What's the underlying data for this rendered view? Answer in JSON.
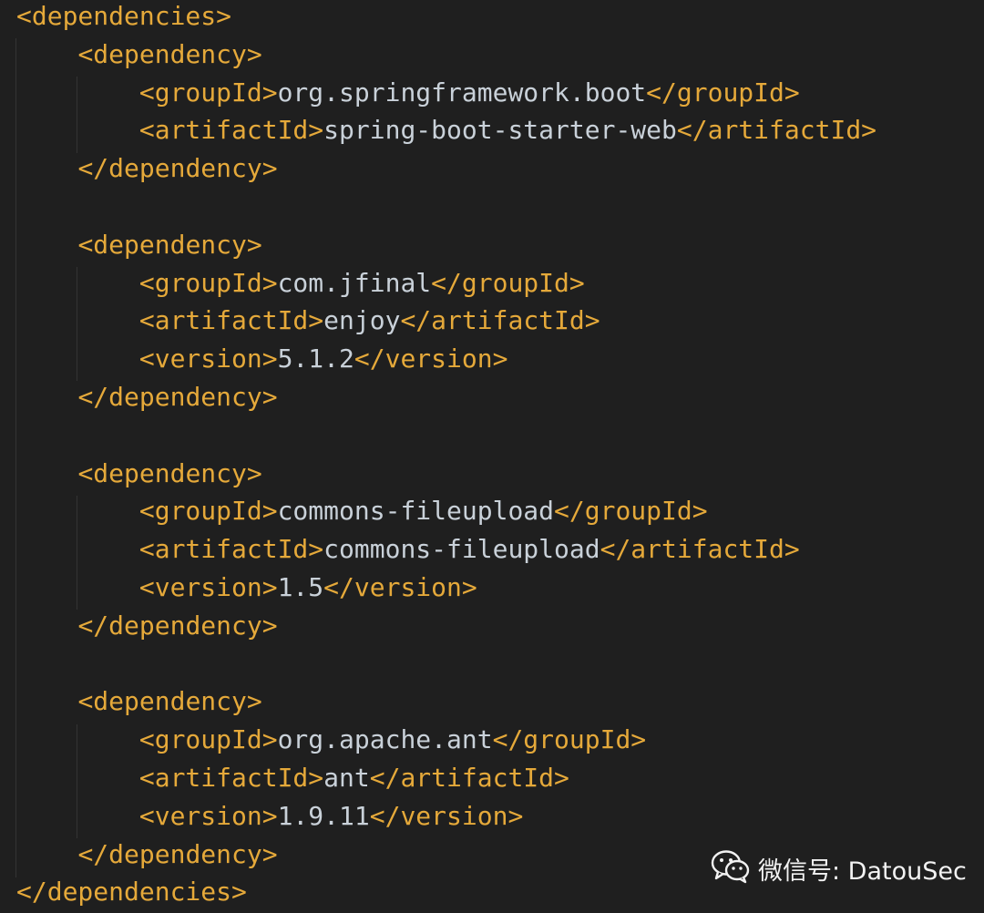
{
  "code": {
    "language": "xml",
    "lines": [
      {
        "indent": 0,
        "parts": [
          {
            "cls": "tag",
            "text": "<dependencies>"
          }
        ]
      },
      {
        "indent": 1,
        "parts": [
          {
            "cls": "tag",
            "text": "<dependency>"
          }
        ]
      },
      {
        "indent": 2,
        "parts": [
          {
            "cls": "tag",
            "text": "<groupId>"
          },
          {
            "cls": "txt",
            "text": "org.springframework.boot"
          },
          {
            "cls": "tag",
            "text": "</groupId>"
          }
        ]
      },
      {
        "indent": 2,
        "parts": [
          {
            "cls": "tag",
            "text": "<artifactId>"
          },
          {
            "cls": "txt",
            "text": "spring-boot-starter-web"
          },
          {
            "cls": "tag",
            "text": "</artifactId>"
          }
        ]
      },
      {
        "indent": 1,
        "parts": [
          {
            "cls": "tag",
            "text": "</dependency>"
          }
        ]
      },
      {
        "indent": 0,
        "parts": []
      },
      {
        "indent": 1,
        "parts": [
          {
            "cls": "tag",
            "text": "<dependency>"
          }
        ]
      },
      {
        "indent": 2,
        "parts": [
          {
            "cls": "tag",
            "text": "<groupId>"
          },
          {
            "cls": "txt",
            "text": "com.jfinal"
          },
          {
            "cls": "tag",
            "text": "</groupId>"
          }
        ]
      },
      {
        "indent": 2,
        "parts": [
          {
            "cls": "tag",
            "text": "<artifactId>"
          },
          {
            "cls": "txt",
            "text": "enjoy"
          },
          {
            "cls": "tag",
            "text": "</artifactId>"
          }
        ]
      },
      {
        "indent": 2,
        "parts": [
          {
            "cls": "tag",
            "text": "<version>"
          },
          {
            "cls": "txt",
            "text": "5.1.2"
          },
          {
            "cls": "tag",
            "text": "</version>"
          }
        ]
      },
      {
        "indent": 1,
        "parts": [
          {
            "cls": "tag",
            "text": "</dependency>"
          }
        ]
      },
      {
        "indent": 0,
        "parts": []
      },
      {
        "indent": 1,
        "parts": [
          {
            "cls": "tag",
            "text": "<dependency>"
          }
        ]
      },
      {
        "indent": 2,
        "parts": [
          {
            "cls": "tag",
            "text": "<groupId>"
          },
          {
            "cls": "txt",
            "text": "commons-fileupload"
          },
          {
            "cls": "tag",
            "text": "</groupId>"
          }
        ]
      },
      {
        "indent": 2,
        "parts": [
          {
            "cls": "tag",
            "text": "<artifactId>"
          },
          {
            "cls": "txt",
            "text": "commons-fileupload"
          },
          {
            "cls": "tag",
            "text": "</artifactId>"
          }
        ]
      },
      {
        "indent": 2,
        "parts": [
          {
            "cls": "tag",
            "text": "<version>"
          },
          {
            "cls": "txt",
            "text": "1.5"
          },
          {
            "cls": "tag",
            "text": "</version>"
          }
        ]
      },
      {
        "indent": 1,
        "parts": [
          {
            "cls": "tag",
            "text": "</dependency>"
          }
        ]
      },
      {
        "indent": 0,
        "parts": []
      },
      {
        "indent": 1,
        "parts": [
          {
            "cls": "tag",
            "text": "<dependency>"
          }
        ]
      },
      {
        "indent": 2,
        "parts": [
          {
            "cls": "tag",
            "text": "<groupId>"
          },
          {
            "cls": "txt",
            "text": "org.apache.ant"
          },
          {
            "cls": "tag",
            "text": "</groupId>"
          }
        ]
      },
      {
        "indent": 2,
        "parts": [
          {
            "cls": "tag",
            "text": "<artifactId>"
          },
          {
            "cls": "txt",
            "text": "ant"
          },
          {
            "cls": "tag",
            "text": "</artifactId>"
          }
        ]
      },
      {
        "indent": 2,
        "parts": [
          {
            "cls": "tag",
            "text": "<version>"
          },
          {
            "cls": "txt",
            "text": "1.9.11"
          },
          {
            "cls": "tag",
            "text": "</version>"
          }
        ]
      },
      {
        "indent": 1,
        "parts": [
          {
            "cls": "tag",
            "text": "</dependency>"
          }
        ]
      },
      {
        "indent": 0,
        "parts": [
          {
            "cls": "tag",
            "text": "</dependencies>"
          }
        ]
      }
    ]
  },
  "watermark": {
    "icon": "wechat-icon",
    "label": "微信号: DatouSec"
  },
  "colors": {
    "background": "#1f1f1f",
    "tag": "#e5a93a",
    "text": "#c9d1d9",
    "indent_guide": "#343434"
  }
}
